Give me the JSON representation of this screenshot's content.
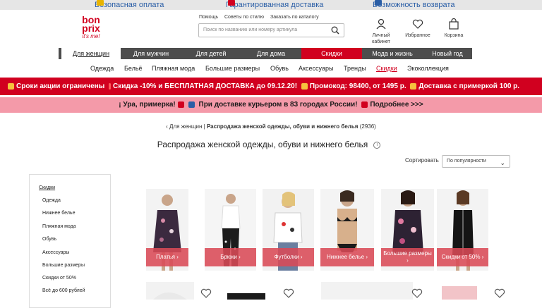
{
  "topbar": {
    "items": [
      "Безопасная оплата",
      "Гарантированная доставка",
      "Возможность возврата"
    ]
  },
  "header": {
    "logo_line1": "bon",
    "logo_line2": "prix",
    "logo_tag": "it's me!",
    "links": [
      "Помощь",
      "Советы по стилю",
      "Заказать по каталогу"
    ],
    "search_placeholder": "Поиск по названию или номеру артикула",
    "account_line1": "Личный",
    "account_line2": "кабинет",
    "favorites": "Избранное",
    "cart": "Корзина"
  },
  "nav": {
    "items": [
      "Для женщин",
      "Для мужчин",
      "Для детей",
      "Для дома",
      "Скидки",
      "Мода и жизнь",
      "Новый год"
    ]
  },
  "subnav": {
    "items": [
      "Одежда",
      "Бельё",
      "Пляжная мода",
      "Большие размеры",
      "Обувь",
      "Аксессуары",
      "Тренды",
      "Скидки",
      "Экоколлекция"
    ]
  },
  "promo1": {
    "part1": "Сроки акции ограничены",
    "part2": "Скидка -10% и БЕСПЛАТНАЯ ДОСТАВКА до 09.12.20!",
    "part3": "Промокод: 98400, от 1495 р.",
    "part4": "Доставка с примеркой 100 р."
  },
  "promo2": {
    "part1": "¡ Ура, примерка!",
    "part2": "При доставке курьером в 83 городах России!",
    "part3": "Подробнее >>>"
  },
  "breadcrumb": {
    "back": "‹ Для женщин",
    "sep": "|",
    "current": "Распродажа женской одежды, обуви и нижнего белья",
    "count": "(2936)"
  },
  "page_title": "Распродажа женской одежды, обуви и нижнего белья",
  "sort": {
    "label": "Сортировать",
    "value": "По популярности"
  },
  "sidebar": {
    "heading": "Скидки",
    "items": [
      "Одежда",
      "Нижнее белье",
      "Пляжная мода",
      "Обувь",
      "Аксессуары",
      "Большие размеры",
      "Скидки от 50%",
      "Всё до 600 рублей"
    ]
  },
  "categories": [
    {
      "label": "Платья ›"
    },
    {
      "label": "Брюки ›"
    },
    {
      "label": "Футболки ›"
    },
    {
      "label": "Нижнее белье ›"
    },
    {
      "label": "Большие размеры ›"
    },
    {
      "label": "Скидки от 50% ›"
    }
  ],
  "colors": {
    "brand_red": "#d1001f",
    "nav_dark": "#4d4d4d",
    "promo_pink": "#f49aa9",
    "link_blue": "#2a5ea6"
  }
}
